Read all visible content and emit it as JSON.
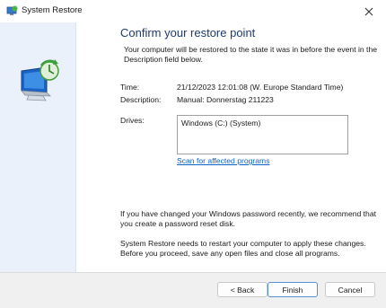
{
  "window": {
    "title": "System Restore",
    "close_glyph": "✕",
    "icons": {
      "app": "system-restore-icon",
      "close": "close-icon",
      "hero": "system-restore-monitor-icon"
    }
  },
  "content": {
    "heading": "Confirm your restore point",
    "intro": "Your computer will be restored to the state it was in before the event in the Description field below.",
    "time_label": "Time:",
    "time_value": "21/12/2023 12:01:08 (W. Europe Standard Time)",
    "description_label": "Description:",
    "description_value": "Manual: Donnerstag 211223",
    "drives_label": "Drives:",
    "drives": [
      "Windows (C:) (System)"
    ],
    "scan_link": "Scan for affected programs",
    "password_note": "If you have changed your Windows password recently, we recommend that you create a password reset disk.",
    "restart_note": "System Restore needs to restart your computer to apply these changes. Before you proceed, save any open files and close all programs."
  },
  "buttons": {
    "back": "< Back",
    "finish": "Finish",
    "cancel": "Cancel"
  },
  "colors": {
    "heading": "#1e3a6e",
    "link": "#0b63c5",
    "side_panel": "#eaf1fb",
    "footer": "#f0f0f0"
  }
}
